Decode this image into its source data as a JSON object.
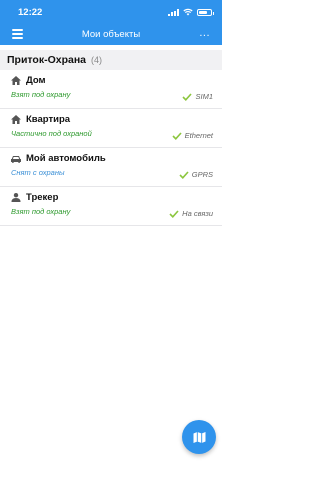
{
  "status_bar": {
    "time": "12:22",
    "battery_level": 0.7
  },
  "header": {
    "title": "Мои объекты",
    "more_label": "...",
    "color": "#2f93ec"
  },
  "group": {
    "title": "Приток-Охрана",
    "count": "(4)"
  },
  "items": [
    {
      "name": "Дом",
      "icon": "home-icon",
      "status": "Взят под охрану",
      "status_color": "#2e9a2e",
      "connection": "SIM1"
    },
    {
      "name": "Квартира",
      "icon": "home-icon",
      "status": "Частично под охраной",
      "status_color": "#2e9a2e",
      "connection": "Ethernet"
    },
    {
      "name": "Мой автомобиль",
      "icon": "car-icon",
      "status": "Снят с охраны",
      "status_color": "#3a8fd6",
      "connection": "GPRS"
    },
    {
      "name": "Трекер",
      "icon": "person-icon",
      "status": "Взят под охрану",
      "status_color": "#2e9a2e",
      "connection": "На связи"
    }
  ],
  "fab": {
    "icon": "map-icon"
  }
}
